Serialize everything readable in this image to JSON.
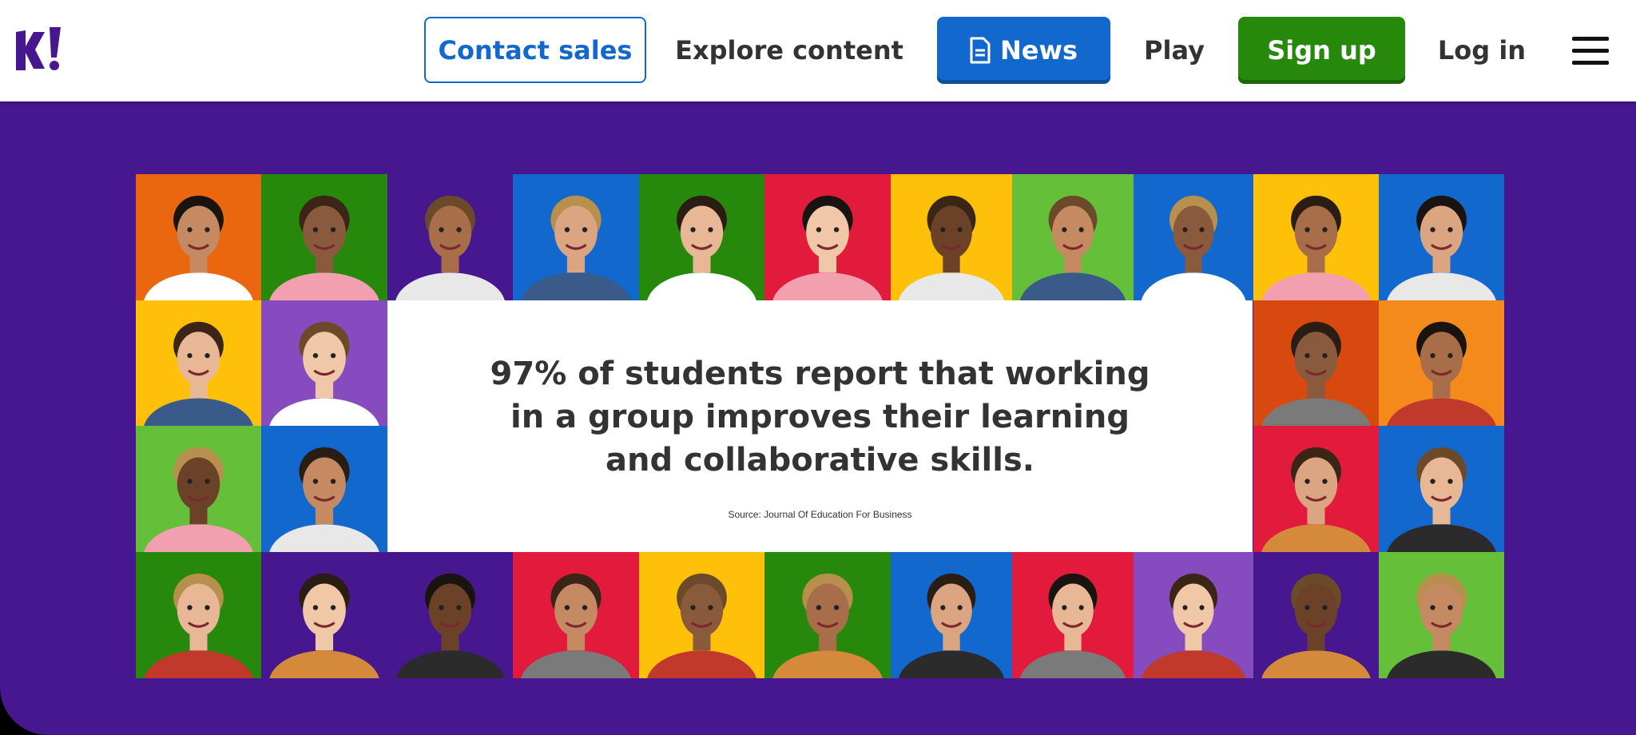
{
  "header": {
    "logo_text": "K!",
    "contact_sales": "Contact sales",
    "explore_content": "Explore content",
    "news": "News",
    "play": "Play",
    "sign_up": "Sign up",
    "log_in": "Log in"
  },
  "hero": {
    "quote": "97% of students report that working in a group improves their learning and collaborative skills.",
    "source": "Source: Journal Of Education For Business"
  },
  "colors": {
    "brand_purple": "#46178f",
    "news_blue": "#1368ce",
    "signup_green": "#26890c",
    "tile_palette": [
      "#eb670f",
      "#26890c",
      "#46178f",
      "#1368ce",
      "#e21b3c",
      "#ffc00a",
      "#66bf39",
      "#864cbf",
      "#d8490f",
      "#f48a1c"
    ]
  },
  "icons": [
    "kahoot-logo-icon",
    "document-icon",
    "hamburger-menu-icon"
  ]
}
